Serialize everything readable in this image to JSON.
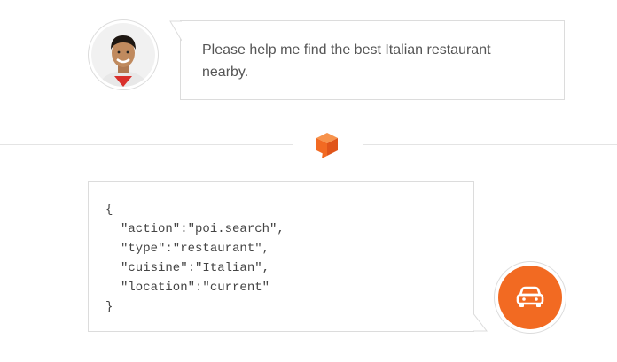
{
  "user_message": {
    "text": "Please help me find the best Italian restaurant nearby.",
    "avatar_icon": "user-avatar"
  },
  "divider": {
    "icon": "chat-box-logo-icon",
    "color": "#f26a22"
  },
  "bot_response": {
    "open_brace": "{",
    "close_brace": "}",
    "lines": [
      "\"action\":\"poi.search\",",
      "\"type\":\"restaurant\",",
      "\"cuisine\":\"Italian\",",
      "\"location\":\"current\""
    ],
    "avatar_icon": "car-icon",
    "accent_color": "#f26a22"
  }
}
